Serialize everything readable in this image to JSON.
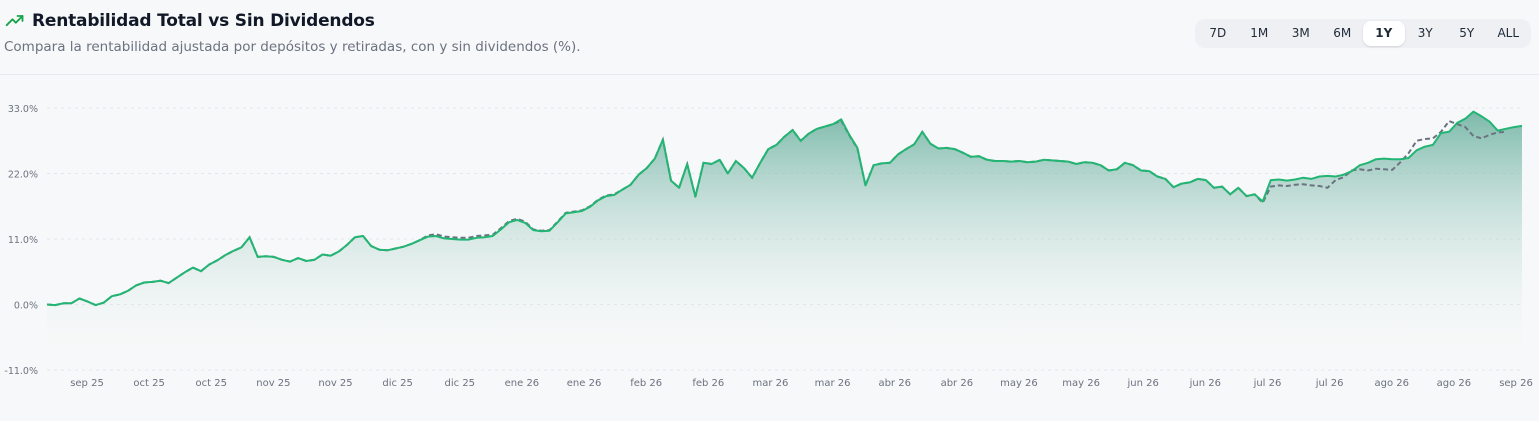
{
  "header": {
    "title": "Rentabilidad Total vs Sin Dividendos",
    "subtitle": "Compara la rentabilidad ajustada por depósitos y retiradas, con y sin dividendos (%).",
    "icon": "trending-up-icon",
    "ranges": [
      "7D",
      "1M",
      "3M",
      "6M",
      "1Y",
      "3Y",
      "5Y",
      "ALL"
    ],
    "active_range": "1Y"
  },
  "colors": {
    "total_line": "#22b573",
    "no_div_line": "#6b7280",
    "area_top": "#5aa894",
    "accent": "#16a34a"
  },
  "chart_data": {
    "type": "area",
    "title": "Rentabilidad Total vs Sin Dividendos",
    "ylim": [
      -11.0,
      33.0
    ],
    "yticks": [
      "33.0%",
      "22.0%",
      "11.0%",
      "0.0%",
      "-11.0%"
    ],
    "ytick_values": [
      33,
      22,
      11,
      0,
      -11
    ],
    "xticks": [
      "sep 25",
      "oct 25",
      "oct 25",
      "nov 25",
      "nov 25",
      "dic 25",
      "dic 25",
      "ene 26",
      "ene 26",
      "feb 26",
      "feb 26",
      "mar 26",
      "mar 26",
      "abr 26",
      "abr 26",
      "may 26",
      "may 26",
      "jun 26",
      "jun 26",
      "jul 26",
      "jul 26",
      "ago 26",
      "ago 26",
      "sep 26"
    ],
    "grid": true,
    "legend": "none",
    "series": [
      {
        "key": "total",
        "style": "solid",
        "values": [
          0.0,
          -0.1,
          0.2,
          0.2,
          1.0,
          0.5,
          -0.1,
          0.3,
          1.4,
          1.7,
          2.3,
          3.2,
          3.7,
          3.8,
          4.0,
          3.6,
          4.5,
          5.4,
          6.2,
          5.6,
          6.7,
          7.4,
          8.3,
          9.0,
          9.6,
          11.3,
          8.0,
          8.1,
          8.0,
          7.5,
          7.2,
          7.8,
          7.3,
          7.5,
          8.4,
          8.2,
          8.9,
          10.0,
          11.3,
          11.5,
          9.8,
          9.2,
          9.1,
          9.4,
          9.7,
          10.2,
          10.8,
          11.4,
          11.5,
          11.1,
          11.0,
          10.9,
          10.9,
          11.2,
          11.3,
          11.5,
          12.6,
          13.8,
          14.2,
          13.7,
          12.5,
          12.3,
          12.4,
          13.8,
          15.3,
          15.5,
          15.7,
          16.4,
          17.5,
          18.2,
          18.4,
          19.3,
          20.1,
          21.8,
          22.9,
          24.5,
          27.7,
          20.8,
          19.6,
          23.6,
          18.1,
          23.8,
          23.6,
          24.3,
          22.0,
          24.1,
          22.9,
          21.3,
          23.8,
          26.1,
          26.8,
          28.2,
          29.3,
          27.5,
          28.7,
          29.5,
          29.9,
          30.3,
          31.1,
          28.5,
          26.3,
          20.0,
          23.4,
          23.7,
          23.8,
          25.2,
          26.1,
          26.9,
          29.0,
          27.0,
          26.2,
          26.3,
          26.1,
          25.5,
          24.8,
          24.9,
          24.3,
          24.1,
          24.1,
          24.0,
          24.1,
          23.9,
          24.0,
          24.3,
          24.2,
          24.1,
          24.0,
          23.6,
          23.9,
          23.8,
          23.4,
          22.5,
          22.7,
          23.8,
          23.4,
          22.5,
          22.4,
          21.5,
          21.1,
          19.7,
          20.3,
          20.5,
          21.1,
          20.9,
          19.6,
          19.8,
          18.5,
          19.6,
          18.2,
          18.5,
          17.3,
          20.9,
          21.0,
          20.8,
          21.0,
          21.3,
          21.1,
          21.5,
          21.6,
          21.5,
          21.8,
          22.4,
          23.4,
          23.8,
          24.4,
          24.5,
          24.4,
          24.4,
          24.6,
          25.9,
          26.5,
          26.8,
          28.8,
          29.0,
          30.5,
          31.2,
          32.4,
          31.6,
          30.7,
          29.2,
          29.5,
          29.8,
          30.0
        ],
        "date_range": [
          "sep 25",
          "sep 26"
        ]
      },
      {
        "key": "sin_dividendos",
        "style": "dashed",
        "values": [
          0.0,
          -0.1,
          0.2,
          0.2,
          1.0,
          0.5,
          -0.1,
          0.3,
          1.4,
          1.7,
          2.3,
          3.2,
          3.7,
          3.8,
          4.0,
          3.6,
          4.5,
          5.4,
          6.2,
          5.6,
          6.7,
          7.4,
          8.3,
          9.0,
          9.6,
          11.3,
          8.0,
          8.1,
          8.0,
          7.5,
          7.2,
          7.8,
          7.3,
          7.5,
          8.4,
          8.2,
          8.9,
          10.0,
          11.3,
          11.5,
          9.8,
          9.2,
          9.1,
          9.4,
          9.7,
          10.2,
          10.8,
          11.6,
          11.8,
          11.4,
          11.3,
          11.2,
          11.2,
          11.5,
          11.6,
          11.7,
          12.8,
          14.0,
          14.4,
          13.9,
          12.6,
          12.4,
          12.5,
          13.9,
          15.4,
          15.6,
          15.8,
          16.5,
          17.6,
          18.3,
          18.5,
          19.3,
          20.1,
          21.8,
          22.9,
          24.5,
          27.7,
          20.8,
          19.6,
          23.6,
          18.1,
          23.8,
          23.6,
          24.3,
          22.0,
          24.1,
          22.9,
          21.3,
          23.8,
          26.1,
          26.8,
          28.2,
          29.3,
          27.5,
          28.7,
          29.5,
          29.9,
          30.3,
          30.9,
          28.4,
          26.2,
          20.0,
          23.4,
          23.7,
          23.8,
          25.2,
          26.1,
          26.9,
          29.0,
          27.0,
          26.2,
          26.3,
          26.1,
          25.5,
          24.8,
          24.9,
          24.3,
          24.1,
          24.1,
          24.0,
          24.1,
          23.9,
          24.0,
          24.3,
          24.2,
          24.1,
          24.0,
          23.6,
          23.9,
          23.8,
          23.4,
          22.5,
          22.7,
          23.8,
          23.4,
          22.5,
          22.4,
          21.5,
          21.1,
          19.7,
          20.3,
          20.5,
          21.1,
          20.9,
          19.6,
          19.8,
          18.5,
          19.6,
          18.2,
          18.5,
          17.1,
          19.8,
          20.0,
          19.9,
          20.1,
          20.2,
          20.0,
          19.9,
          19.6,
          20.9,
          21.4,
          22.5,
          22.7,
          22.5,
          22.8,
          22.7,
          22.6,
          23.9,
          25.4,
          27.5,
          27.8,
          27.9,
          29.0,
          30.8,
          30.3,
          29.8,
          28.3,
          27.9,
          28.5,
          28.9,
          29.0
        ],
        "date_range": [
          "sep 25",
          "sep 26"
        ]
      }
    ]
  }
}
